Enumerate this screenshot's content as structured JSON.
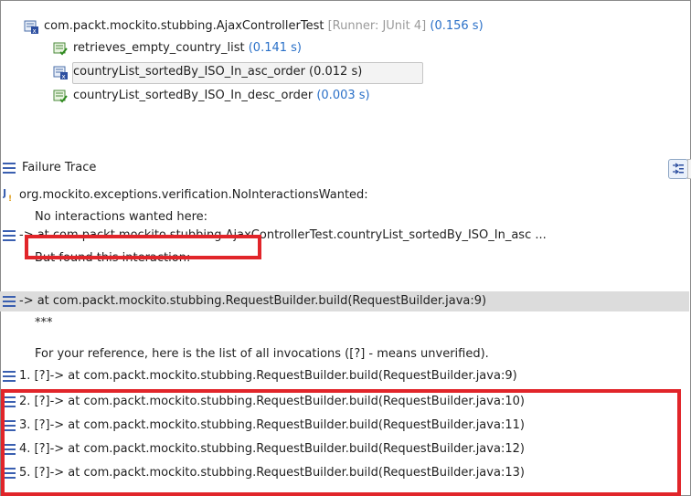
{
  "test_tree": {
    "suite": {
      "name": "com.packt.mockito.stubbing.AjaxControllerTest",
      "runner": "[Runner: JUnit 4]",
      "time": "(0.156 s)"
    },
    "tests": [
      {
        "name": "retrieves_empty_country_list",
        "time": "(0.141 s)",
        "status": "pass"
      },
      {
        "name": "countryList_sortedBy_ISO_In_asc_order (0.012 s)",
        "time": "",
        "status": "fail"
      },
      {
        "name": "countryList_sortedBy_ISO_In_desc_order",
        "time": "(0.003 s)",
        "status": "pass"
      }
    ]
  },
  "failure_trace": {
    "title": "Failure Trace",
    "lines": [
      "org.mockito.exceptions.verification.NoInteractionsWanted:",
      "No interactions wanted here:",
      "-> at com.packt.mockito.stubbing.AjaxControllerTest.countryList_sortedBy_ISO_In_asc ...",
      "But found this interaction:",
      "-> at com.packt.mockito.stubbing.RequestBuilder.build(RequestBuilder.java:9)",
      "***",
      "For your reference, here is the list of all invocations ([?] - means unverified).",
      "1. [?]-> at com.packt.mockito.stubbing.RequestBuilder.build(RequestBuilder.java:9)",
      "2. [?]-> at com.packt.mockito.stubbing.RequestBuilder.build(RequestBuilder.java:10)",
      "3. [?]-> at com.packt.mockito.stubbing.RequestBuilder.build(RequestBuilder.java:11)",
      "4. [?]-> at com.packt.mockito.stubbing.RequestBuilder.build(RequestBuilder.java:12)",
      "5. [?]-> at com.packt.mockito.stubbing.RequestBuilder.build(RequestBuilder.java:13)"
    ]
  },
  "colors": {
    "highlight": "#e1252a",
    "time": "#2a70c8",
    "stack_icon": "#3a5fb0"
  }
}
